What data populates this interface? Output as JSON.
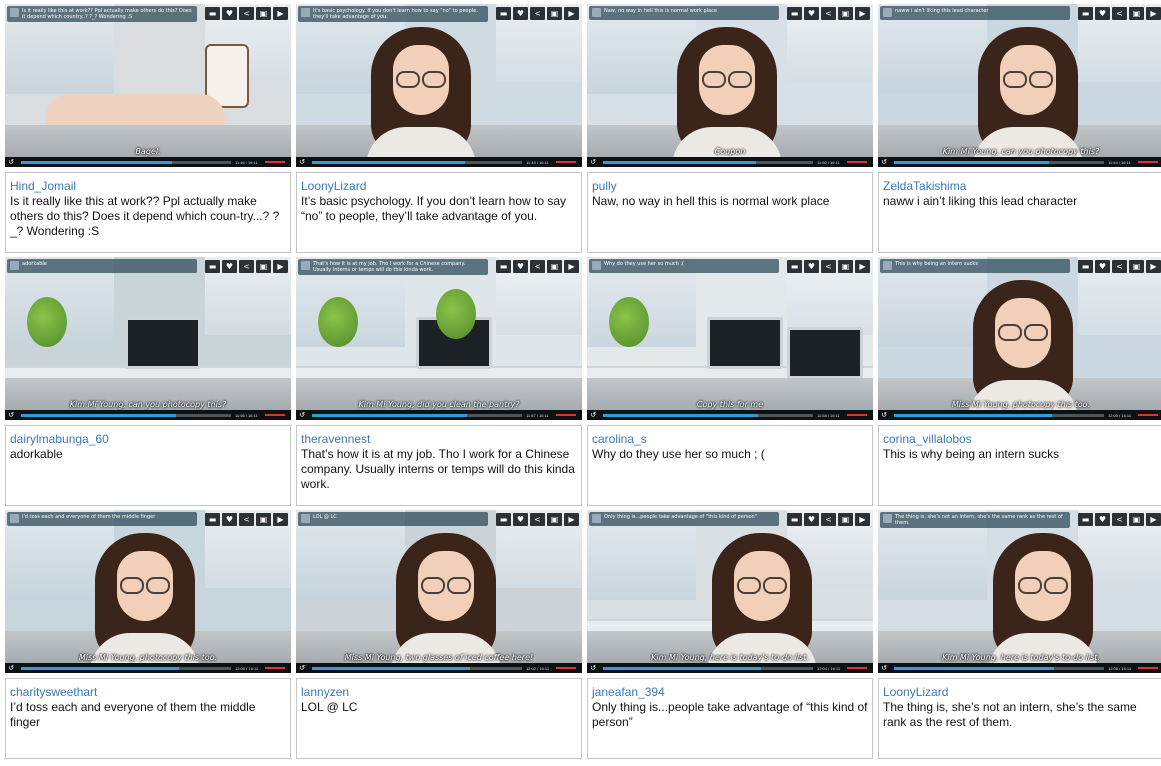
{
  "icon_buttons": [
    "speech-bubble-icon",
    "heart-icon",
    "share-icon",
    "translate-icon",
    "next-icon"
  ],
  "cards": [
    {
      "overlay_user": "Hind_Jomail",
      "overlay_text": "Is it really like this at work?? Ppl actually make others do this? Does it depend which country..? ?_? Wondering :S",
      "subtitle": "Bagel.",
      "timecode": "11:46 / 16:11",
      "progress": 0.72,
      "username": "Hind_Jomail",
      "comment": "Is it really like this at work?? Ppl actually make others do this? Does it depend which coun-try...? ?_? Wondering :S"
    },
    {
      "overlay_user": "LoonyLizard",
      "overlay_text": "It's basic psychology. If you don't learn how to say \"no\" to people, they'll take advantage of you.",
      "subtitle": "",
      "timecode": "11:48 / 16:11",
      "progress": 0.73,
      "username": "LoonyLizard",
      "comment": "It’s basic psychology. If you don’t learn how to say “no” to people, they’ll take advantage of you."
    },
    {
      "overlay_user": "pully",
      "overlay_text": "Naw, no way in hell this is normal work place",
      "subtitle": "Coupon",
      "timecode": "11:50 / 16:11",
      "progress": 0.73,
      "username": "pully",
      "comment": "Naw, no way in hell this is normal work place"
    },
    {
      "overlay_user": "ZeldaTakishima",
      "overlay_text": "naww i ain't liking this lead character",
      "subtitle": "Kim Mi Young, can you photocopy this?",
      "timecode": "11:54 / 16:11",
      "progress": 0.74,
      "username": "ZeldaTakishima",
      "comment": "naww i ain’t liking this lead character"
    },
    {
      "overlay_user": "dairylmabunga_60",
      "overlay_text": "adorkable",
      "subtitle": "Kim Mi Young, can you photocopy this?",
      "timecode": "11:56 / 16:11",
      "progress": 0.74,
      "username": "dairylmabunga_60",
      "comment": "adorkable"
    },
    {
      "overlay_user": "theravennest",
      "overlay_text": "That's how it is at my job. Tho I work for a Chinese company. Usually interns or temps will do this kinda work.",
      "subtitle": "Kim Mi Young, did you clean the pantry?",
      "timecode": "11:57 / 16:11",
      "progress": 0.74,
      "username": "theravennest",
      "comment": "That’s how it is at my job. Tho I work for a Chinese company. Usually interns or temps will do this kinda work."
    },
    {
      "overlay_user": "carolina_s",
      "overlay_text": "Why do they use her so much ;(",
      "subtitle": "Copy this for me",
      "timecode": "11:58 / 16:11",
      "progress": 0.74,
      "username": "carolina_s",
      "comment": "Why do they use her so much ; ("
    },
    {
      "overlay_user": "corina_villalobos",
      "overlay_text": "This is why being an intern sucks",
      "subtitle": "Miss Mi Young, photocopy this too.",
      "timecode": "12:00 / 16:11",
      "progress": 0.75,
      "username": "corina_villalobos",
      "comment": "This is why being an intern sucks"
    },
    {
      "overlay_user": "charitysweethart",
      "overlay_text": "I'd toss each and everyone of them the middle finger",
      "subtitle": "Miss Mi Young, photocopy this too.",
      "timecode": "12:00 / 16:11",
      "progress": 0.75,
      "username": "charitysweethart",
      "comment": "I’d toss each and everyone of them the middle finger"
    },
    {
      "overlay_user": "lannyzen",
      "overlay_text": "LOL @ LC",
      "subtitle": "Miss Mi Young, two glasses of iced coffee here!",
      "timecode": "12:02 / 16:11",
      "progress": 0.75,
      "username": "lannyzen",
      "comment": "LOL @ LC"
    },
    {
      "overlay_user": "janeafan_394",
      "overlay_text": "Only thing is...people take advantage of \"this kind of person\"",
      "subtitle": "Kim Mi Young, here is today's to-do list.",
      "timecode": "12:04 / 16:11",
      "progress": 0.75,
      "username": "janeafan_394",
      "comment": "Only thing is...people take advantage of “this kind of person”"
    },
    {
      "overlay_user": "LoonyLizard",
      "overlay_text": "The thing is, she's not an intern, she's the same rank as the rest of them.",
      "subtitle": "Kim Mi Young, here is today's to-do list.",
      "timecode": "12:06 / 16:11",
      "progress": 0.76,
      "username": "LoonyLizard",
      "comment": "The thing is, she’s not an intern, she’s the same rank as the rest of them."
    }
  ]
}
